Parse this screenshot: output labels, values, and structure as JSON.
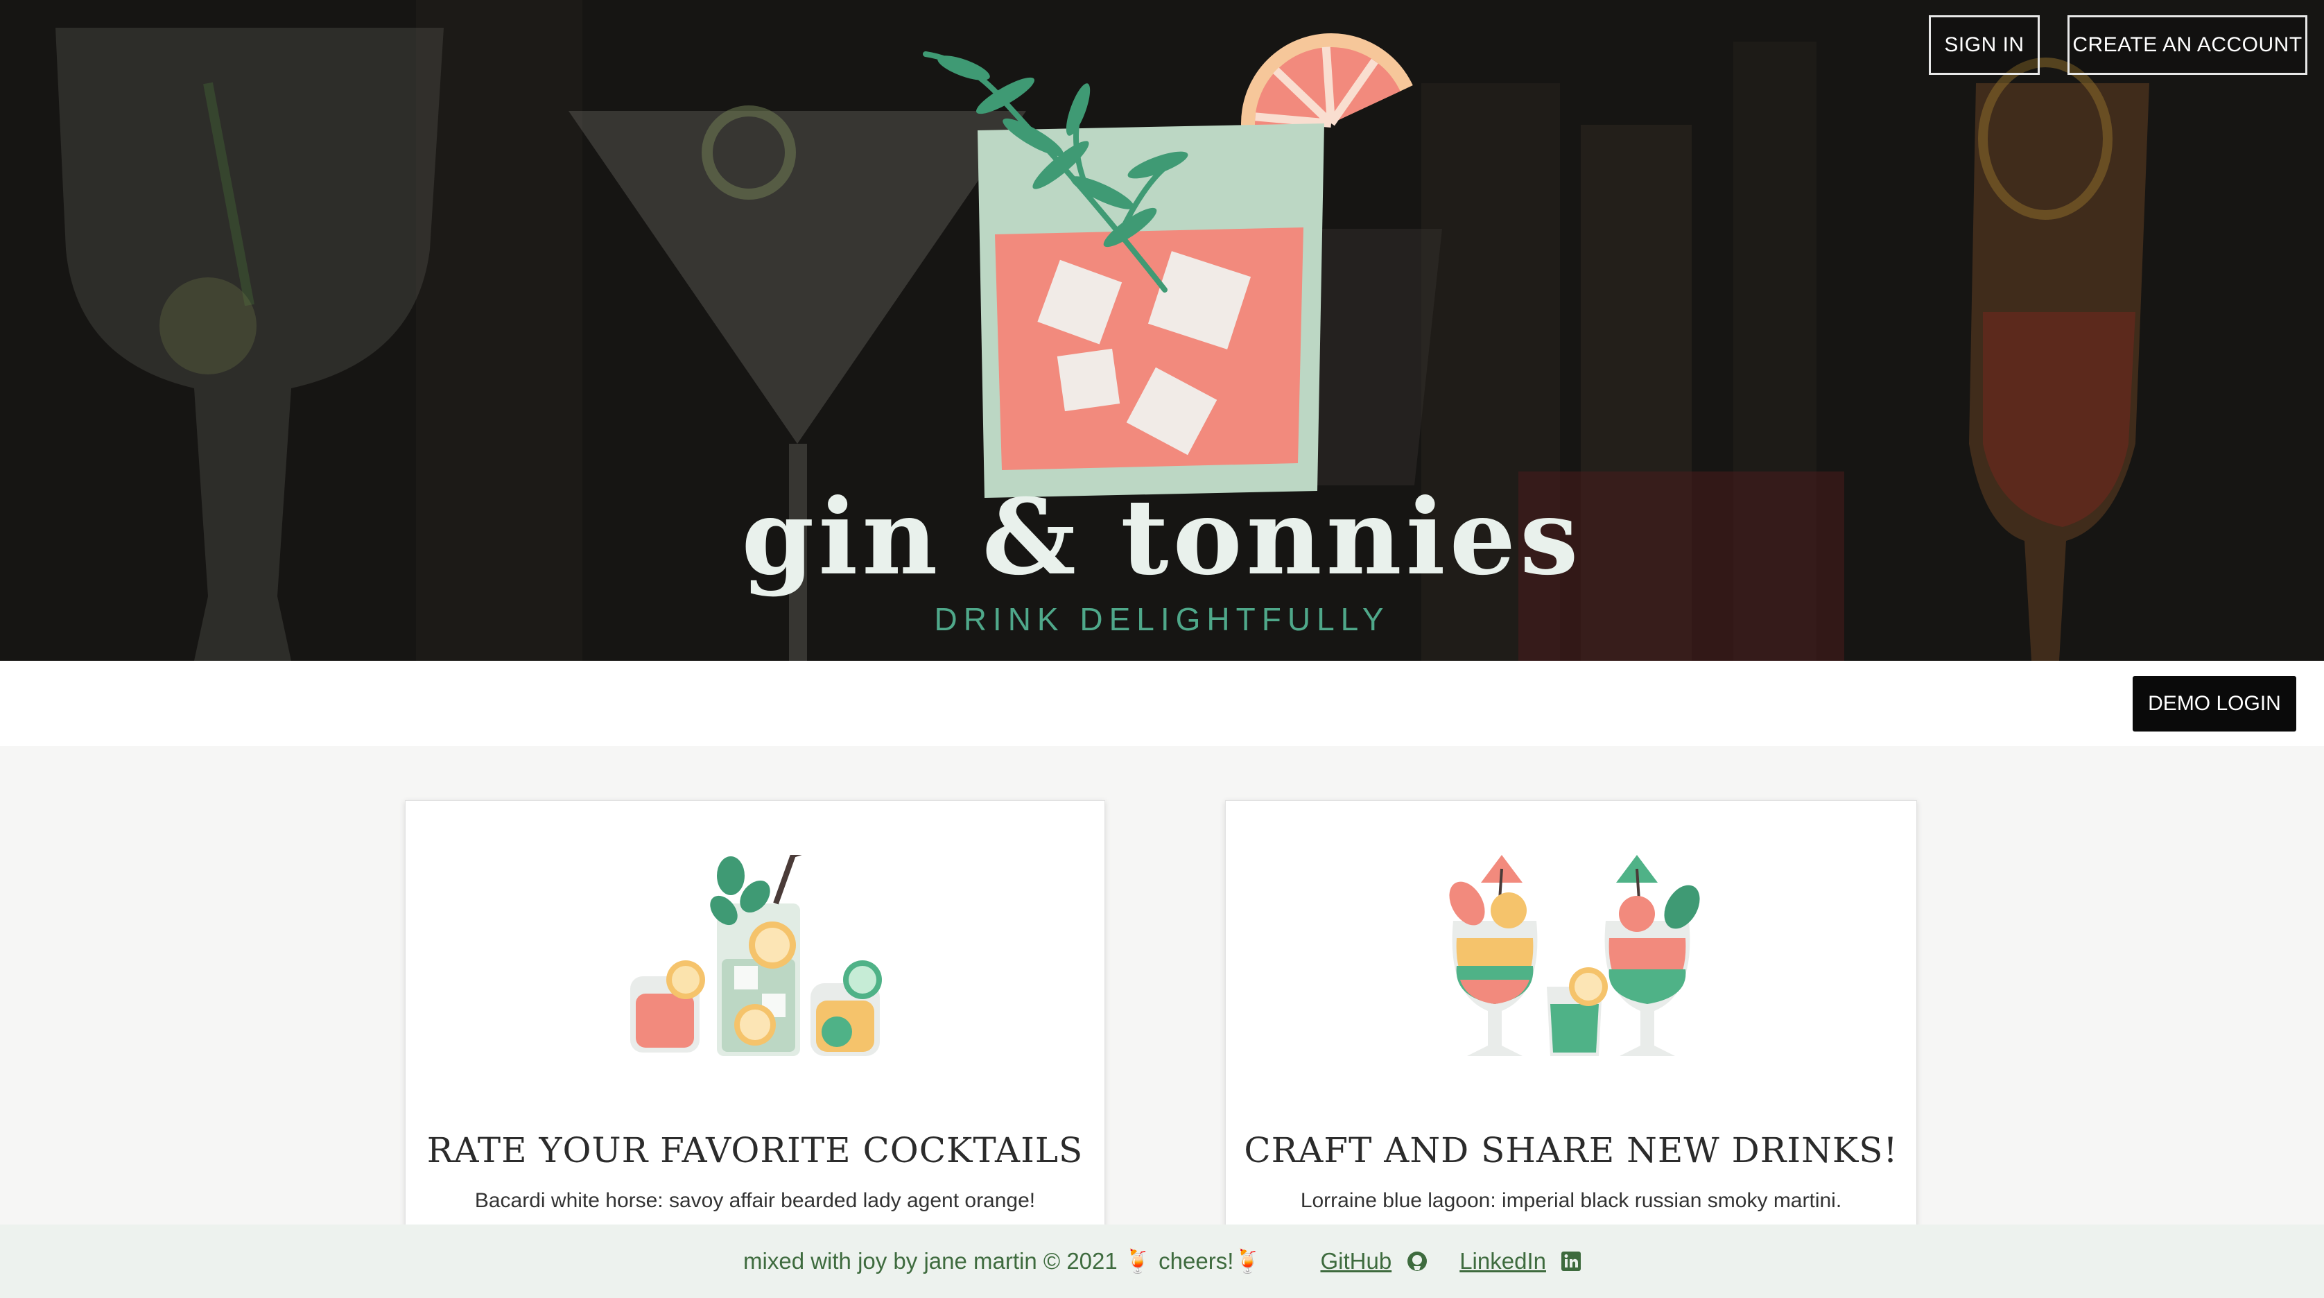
{
  "header": {
    "sign_in_label": "SIGN IN",
    "create_account_label": "CREATE AN ACCOUNT"
  },
  "hero": {
    "brand_name": "gin & tonnies",
    "tagline": "DRINK DELIGHTFULLY"
  },
  "demo": {
    "demo_login_label": "DEMO LOGIN"
  },
  "features": [
    {
      "title": "RATE YOUR FAVORITE COCKTAILS",
      "text": "Bacardi white horse: savoy affair bearded lady agent orange!",
      "icon": "cocktail-glasses-illustration"
    },
    {
      "title": "CRAFT AND SHARE NEW DRINKS!",
      "text": "Lorraine blue lagoon: imperial black russian smoky martini.",
      "icon": "tropical-drinks-illustration"
    }
  ],
  "footer": {
    "credit": "mixed with joy by jane martin © 2021  🍹 cheers!🍹",
    "github_label": "GitHub",
    "linkedin_label": "LinkedIn"
  },
  "colors": {
    "accent_green": "#4fa88a",
    "coral": "#f0857a",
    "sage": "#bcd7c4",
    "footer_text": "#3e6b3e"
  }
}
